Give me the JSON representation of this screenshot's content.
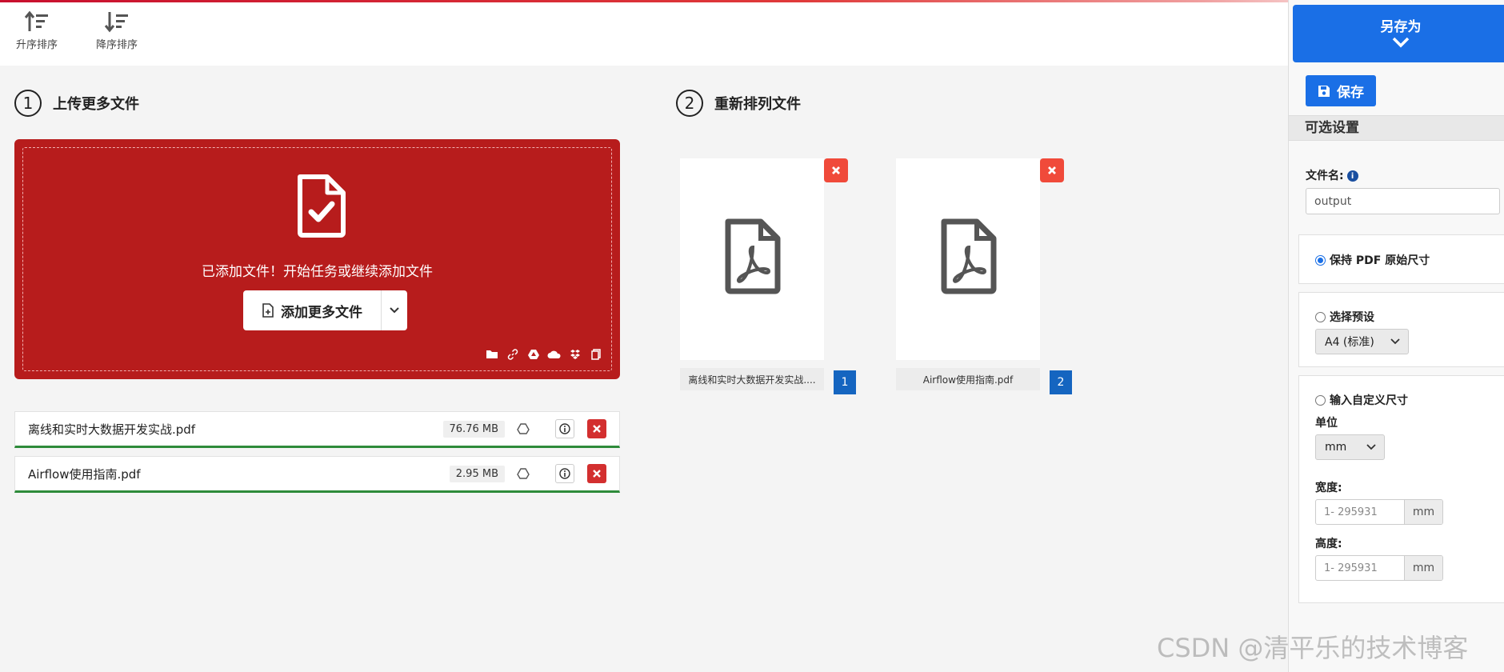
{
  "toolbar": {
    "sort_asc_label": "升序排序",
    "sort_desc_label": "降序排序"
  },
  "steps": {
    "upload": {
      "num": "1",
      "title": "上传更多文件"
    },
    "reorder": {
      "num": "2",
      "title": "重新排列文件"
    }
  },
  "dropzone": {
    "message": "已添加文件！开始任务或继续添加文件",
    "add_button_label": "添加更多文件",
    "sources": [
      "folder-icon",
      "link-icon",
      "google-drive-icon",
      "onedrive-icon",
      "dropbox-icon",
      "clipboard-icon"
    ]
  },
  "files": [
    {
      "name": "离线和实时大数据开发实战.pdf",
      "size": "76.76 MB"
    },
    {
      "name": "Airflow使用指南.pdf",
      "size": "2.95 MB"
    }
  ],
  "thumbnails": [
    {
      "label": "离线和实时大数据开发实战....",
      "num": "1"
    },
    {
      "label": "Airflow使用指南.pdf",
      "num": "2"
    }
  ],
  "sidebar": {
    "save_as_label": "另存为",
    "save_label": "保存",
    "optional_settings_label": "可选设置",
    "filename_label": "文件名:",
    "filename_value": "output",
    "keep_size_label": "保持 PDF 原始尺寸",
    "preset_label": "选择预设",
    "preset_value": "A4 (标准)",
    "custom_label": "输入自定义尺寸",
    "unit_label": "单位",
    "unit_value": "mm",
    "width_label": "宽度:",
    "width_placeholder": "1- 295931",
    "width_unit": "mm",
    "height_label": "高度:",
    "height_placeholder": "1- 295931",
    "height_unit": "mm"
  },
  "watermark": "CSDN @清平乐的技术博客",
  "colors": {
    "brand_red": "#b71c1c",
    "primary_blue": "#1a6fe6",
    "success_green": "#2e8b3a",
    "danger": "#d32f2f"
  }
}
